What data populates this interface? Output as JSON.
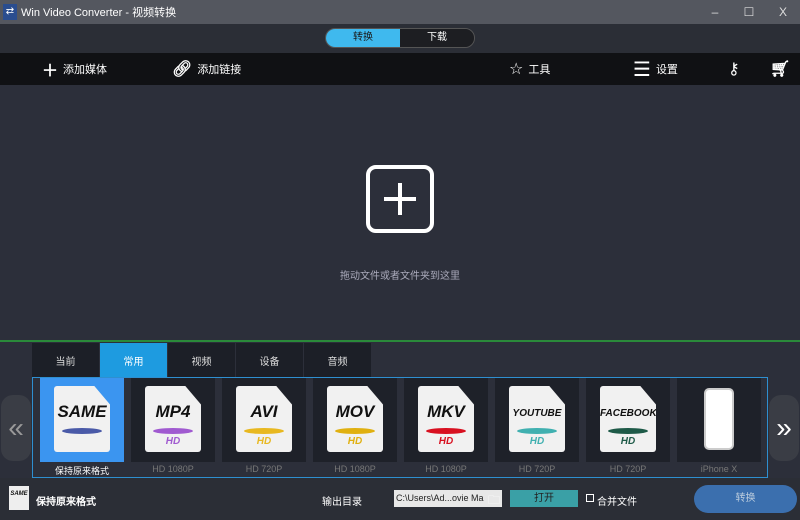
{
  "window": {
    "title": "Win Video Converter - 视频转换",
    "minimize": "–",
    "maximize": "☐",
    "close": "X"
  },
  "mode": {
    "convert": "转换",
    "download": "下载"
  },
  "toolbar": {
    "add_media": "添加媒体",
    "add_link": "添加链接",
    "tools": "工具",
    "settings": "设置"
  },
  "main": {
    "hint": "拖动文件或者文件夹到这里"
  },
  "tabs": [
    {
      "label": "当前"
    },
    {
      "label": "常用"
    },
    {
      "label": "视频"
    },
    {
      "label": "设备"
    },
    {
      "label": "音频"
    }
  ],
  "formats": [
    {
      "name": "SAME",
      "label": "保持原来格式",
      "color": "#4a5aa8",
      "hd": ""
    },
    {
      "name": "MP4",
      "label": "HD 1080P",
      "color": "#a05ad0",
      "hd": "HD"
    },
    {
      "name": "AVI",
      "label": "HD 720P",
      "color": "#e8b820",
      "hd": "HD"
    },
    {
      "name": "MOV",
      "label": "HD 1080P",
      "color": "#e0b010",
      "hd": "HD"
    },
    {
      "name": "MKV",
      "label": "HD 1080P",
      "color": "#d81020",
      "hd": "HD"
    },
    {
      "name": "YOUTUBE",
      "label": "HD 720P",
      "color": "#40b0b0",
      "hd": "HD"
    },
    {
      "name": "FACEBOOK",
      "label": "HD 720P",
      "color": "#1e5a48",
      "hd": "HD"
    },
    {
      "name": "",
      "label": "iPhone X",
      "color": "",
      "hd": ""
    }
  ],
  "bottom": {
    "format": "保持原来格式",
    "mini_icon": "SAME",
    "output_label": "输出目录",
    "path": "C:\\Users\\Ad...ovie Ma",
    "open": "打开",
    "merge": "合并文件",
    "convert": "转换"
  }
}
